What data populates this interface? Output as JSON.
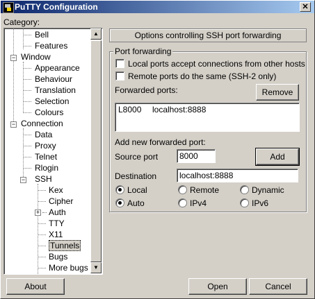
{
  "window": {
    "title": "PuTTY Configuration",
    "close_glyph": "✕"
  },
  "category_label": "Category:",
  "tree": {
    "items": [
      {
        "label": "Bell",
        "level": 2
      },
      {
        "label": "Features",
        "level": 2
      },
      {
        "label": "Window",
        "level": 1,
        "expander": "−"
      },
      {
        "label": "Appearance",
        "level": 2
      },
      {
        "label": "Behaviour",
        "level": 2
      },
      {
        "label": "Translation",
        "level": 2
      },
      {
        "label": "Selection",
        "level": 2
      },
      {
        "label": "Colours",
        "level": 2
      },
      {
        "label": "Connection",
        "level": 1,
        "expander": "−"
      },
      {
        "label": "Data",
        "level": 2
      },
      {
        "label": "Proxy",
        "level": 2
      },
      {
        "label": "Telnet",
        "level": 2
      },
      {
        "label": "Rlogin",
        "level": 2
      },
      {
        "label": "SSH",
        "level": 2,
        "expander": "−"
      },
      {
        "label": "Kex",
        "level": 3
      },
      {
        "label": "Cipher",
        "level": 3
      },
      {
        "label": "Auth",
        "level": 3,
        "expander": "+"
      },
      {
        "label": "TTY",
        "level": 3
      },
      {
        "label": "X11",
        "level": 3
      },
      {
        "label": "Tunnels",
        "level": 3,
        "selected": true
      },
      {
        "label": "Bugs",
        "level": 3
      },
      {
        "label": "More bugs",
        "level": 3
      }
    ]
  },
  "panel": {
    "header": "Options controlling SSH port forwarding",
    "group_title": "Port forwarding",
    "local_ports_accept": {
      "label": "Local ports accept connections from other hosts",
      "checked": false
    },
    "remote_ports_same": {
      "label": "Remote ports do the same (SSH-2 only)",
      "checked": false
    },
    "forwarded_ports_label": "Forwarded ports:",
    "remove_button": "Remove",
    "forwarded_list": [
      {
        "port": "L8000",
        "dest": "localhost:8888"
      }
    ],
    "add_new_label": "Add new forwarded port:",
    "source_port_label": "Source port",
    "source_port_value": "8000",
    "add_button": "Add",
    "destination_label": "Destination",
    "destination_value": "localhost:8888",
    "direction_options": [
      {
        "label": "Local",
        "selected": true
      },
      {
        "label": "Remote",
        "selected": false
      },
      {
        "label": "Dynamic",
        "selected": false
      }
    ],
    "ip_options": [
      {
        "label": "Auto",
        "selected": true
      },
      {
        "label": "IPv4",
        "selected": false
      },
      {
        "label": "IPv6",
        "selected": false
      }
    ]
  },
  "footer": {
    "about": "About",
    "open": "Open",
    "cancel": "Cancel"
  }
}
